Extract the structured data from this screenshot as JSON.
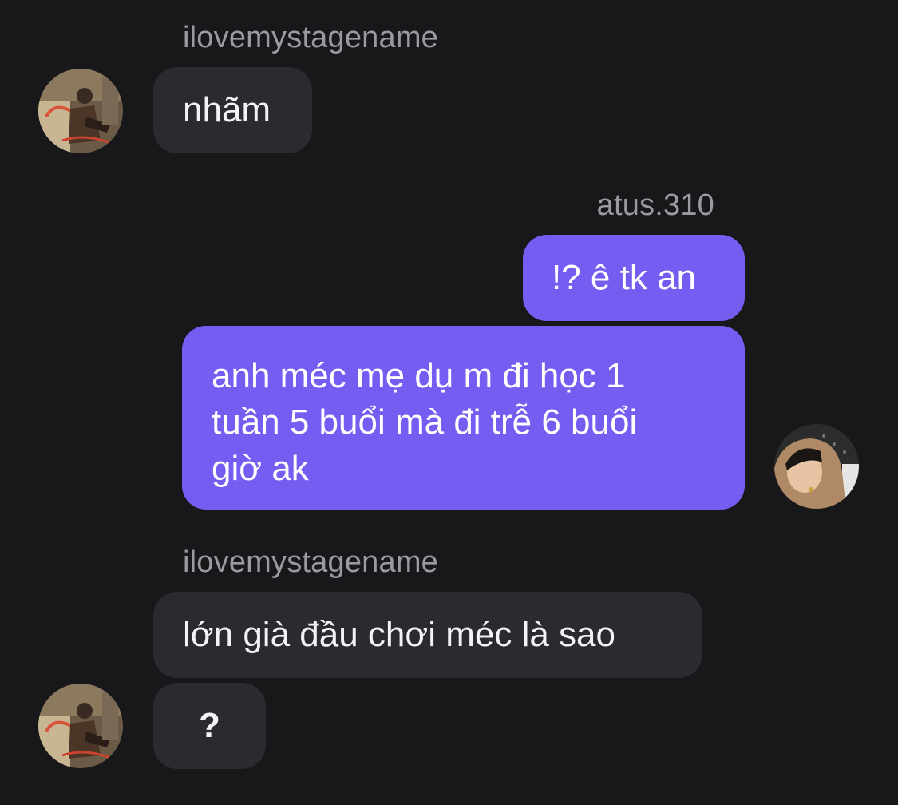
{
  "thread": {
    "messages": [
      {
        "sender": "ilovemystagename",
        "text": "nhãm",
        "direction": "incoming"
      },
      {
        "sender": "atus.310",
        "text": "!? ê tk an",
        "direction": "outgoing"
      },
      {
        "text": "anh méc mẹ dụ m đi học 1\ntuần 5 buổi mà đi trễ 6 buổi\ngiờ ak",
        "direction": "outgoing"
      },
      {
        "sender": "ilovemystagename",
        "text": "lớn già đầu chơi méc là sao",
        "direction": "incoming"
      },
      {
        "text": "?",
        "direction": "incoming"
      }
    ]
  },
  "colors": {
    "background": "#18181b",
    "incoming_bubble": "#2b2b2f",
    "outgoing_bubble": "#765df2",
    "sender_name": "#9a9aa0"
  }
}
